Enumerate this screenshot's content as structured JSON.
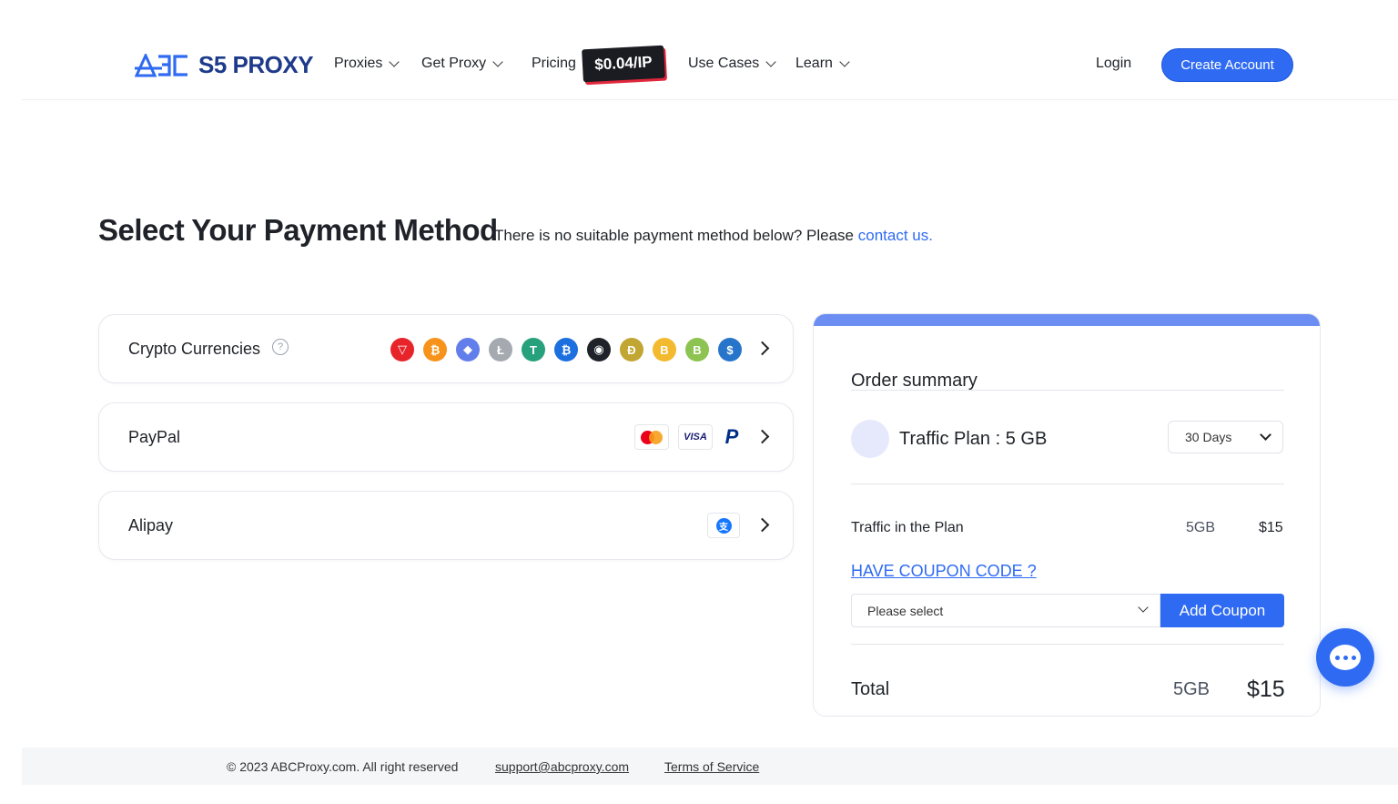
{
  "header": {
    "logo_text": "S5 PROXY",
    "nav": [
      {
        "label": "Proxies"
      },
      {
        "label": "Get Proxy"
      },
      {
        "label": "Pricing"
      },
      {
        "label": "Use Cases"
      },
      {
        "label": "Learn"
      }
    ],
    "price_badge": "$0.04/IP",
    "login": "Login",
    "create_account": "Create Account"
  },
  "page": {
    "title": "Select Your Payment Method",
    "subtitle": "There is no suitable payment method below? Please ",
    "contact_link": "contact us."
  },
  "payment_methods": [
    {
      "label": "Crypto Currencies",
      "icon": "question-icon"
    },
    {
      "label": "PayPal"
    },
    {
      "label": "Alipay"
    }
  ],
  "crypto_coins": [
    {
      "icon": "tron-icon",
      "symbol": "▽",
      "color": "#e8242b"
    },
    {
      "icon": "bitcoin-icon",
      "symbol": "₿",
      "color": "#f7931a"
    },
    {
      "icon": "ethereum-icon",
      "symbol": "◆",
      "color": "#627eea"
    },
    {
      "icon": "litecoin-icon",
      "symbol": "Ł",
      "color": "#a5a9b0"
    },
    {
      "icon": "tether-icon",
      "symbol": "T",
      "color": "#26a17b"
    },
    {
      "icon": "coin-blue-icon",
      "symbol": "₿",
      "color": "#1c6fde"
    },
    {
      "icon": "shiba-icon",
      "symbol": "◉",
      "color": "#1f2329"
    },
    {
      "icon": "dogecoin-icon",
      "symbol": "Đ",
      "color": "#c2a633"
    },
    {
      "icon": "binance-icon",
      "symbol": "B",
      "color": "#f3ba2f"
    },
    {
      "icon": "bitcoin-cash-icon",
      "symbol": "B",
      "color": "#8dc351"
    },
    {
      "icon": "usdc-icon",
      "symbol": "$",
      "color": "#2775ca"
    }
  ],
  "order_summary": {
    "title": "Order summary",
    "plan_label": "Traffic Plan :  5 GB",
    "duration": "30 Days",
    "traffic_label": "Traffic in the Plan",
    "traffic_gb": "5GB",
    "traffic_price": "$15",
    "coupon_link": "HAVE COUPON CODE ?",
    "coupon_placeholder": "Please select",
    "coupon_button": "Add Coupon",
    "total_label": "Total",
    "total_gb": "5GB",
    "total_price": "$15"
  },
  "footer": {
    "copyright": "© 2023 ABCProxy.com. All right reserved",
    "support_email": "support@abcproxy.com",
    "terms": "Terms of Service"
  },
  "colors": {
    "primary": "#2f6bf2",
    "summary_bar": "#6c8ef2",
    "logo": "#1e3a8a"
  }
}
